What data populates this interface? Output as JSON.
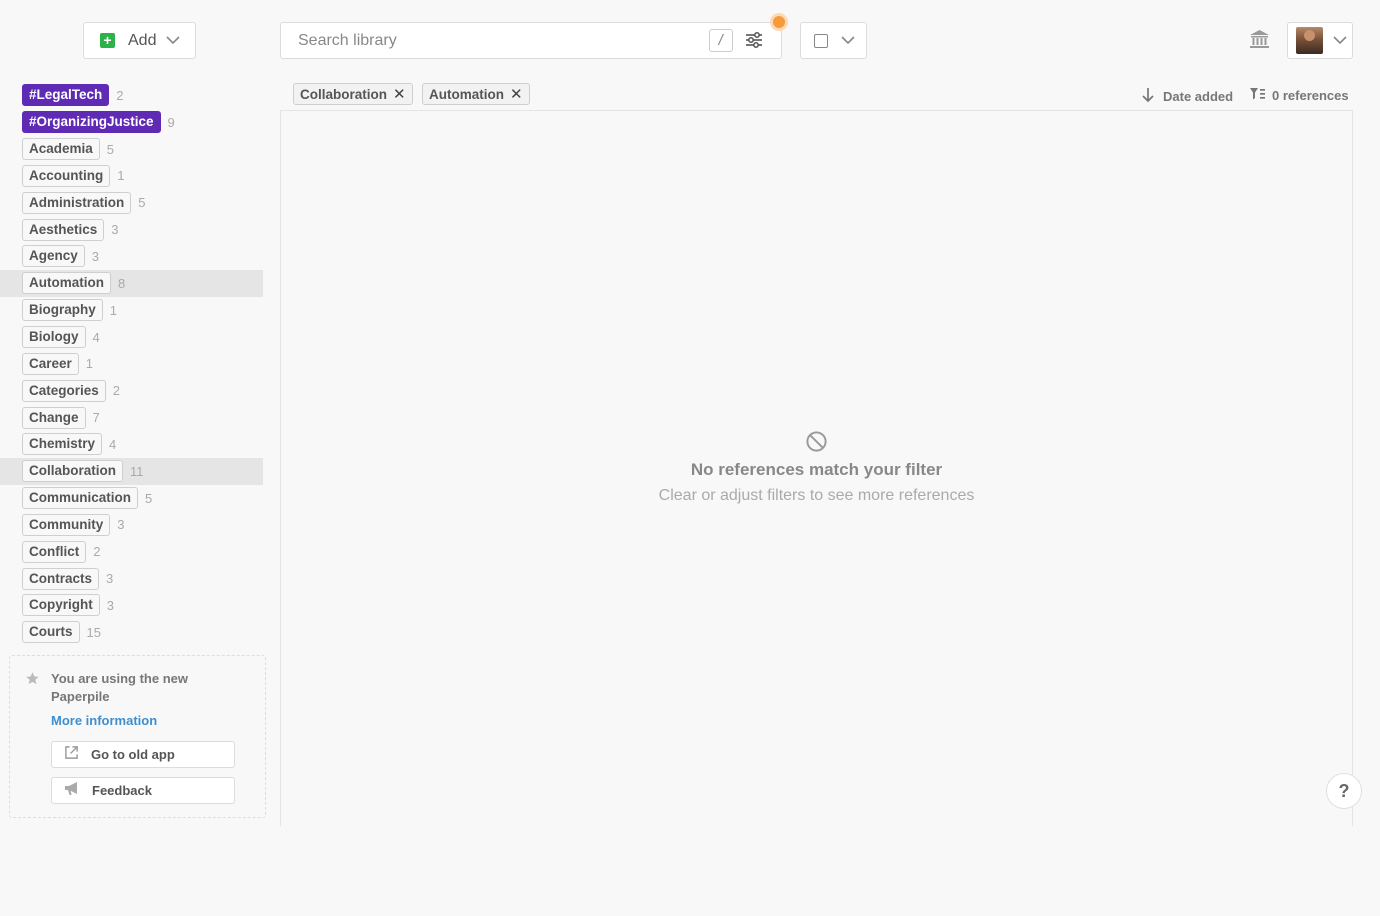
{
  "toolbar": {
    "add_label": "Add",
    "search_placeholder": "Search library",
    "search_value": "",
    "shortcut_key": "/"
  },
  "sidebar": {
    "tags": [
      {
        "label": "#LegalTech",
        "count": "2",
        "style": "purple",
        "selected": false
      },
      {
        "label": "#OrganizingJustice",
        "count": "9",
        "style": "purple",
        "selected": false
      },
      {
        "label": "Academia",
        "count": "5",
        "style": "default",
        "selected": false
      },
      {
        "label": "Accounting",
        "count": "1",
        "style": "default",
        "selected": false
      },
      {
        "label": "Administration",
        "count": "5",
        "style": "default",
        "selected": false
      },
      {
        "label": "Aesthetics",
        "count": "3",
        "style": "default",
        "selected": false
      },
      {
        "label": "Agency",
        "count": "3",
        "style": "default",
        "selected": false
      },
      {
        "label": "Automation",
        "count": "8",
        "style": "default",
        "selected": true
      },
      {
        "label": "Biography",
        "count": "1",
        "style": "default",
        "selected": false
      },
      {
        "label": "Biology",
        "count": "4",
        "style": "default",
        "selected": false
      },
      {
        "label": "Career",
        "count": "1",
        "style": "default",
        "selected": false
      },
      {
        "label": "Categories",
        "count": "2",
        "style": "default",
        "selected": false
      },
      {
        "label": "Change",
        "count": "7",
        "style": "default",
        "selected": false
      },
      {
        "label": "Chemistry",
        "count": "4",
        "style": "default",
        "selected": false
      },
      {
        "label": "Collaboration",
        "count": "11",
        "style": "default",
        "selected": true
      },
      {
        "label": "Communication",
        "count": "5",
        "style": "default",
        "selected": false
      },
      {
        "label": "Community",
        "count": "3",
        "style": "default",
        "selected": false
      },
      {
        "label": "Conflict",
        "count": "2",
        "style": "default",
        "selected": false
      },
      {
        "label": "Contracts",
        "count": "3",
        "style": "default",
        "selected": false
      },
      {
        "label": "Copyright",
        "count": "3",
        "style": "default",
        "selected": false
      },
      {
        "label": "Courts",
        "count": "15",
        "style": "default",
        "selected": false
      }
    ],
    "info": {
      "message": "You are using the new Paperpile",
      "more_link": "More information",
      "old_app_label": "Go to old app",
      "feedback_label": "Feedback"
    }
  },
  "filters": {
    "active": [
      {
        "label": "Collaboration",
        "remove": "✕"
      },
      {
        "label": "Automation",
        "remove": "✕"
      }
    ],
    "sort_label": "Date added",
    "ref_count_label": "0 references"
  },
  "empty_state": {
    "title": "No references match your filter",
    "subtitle": "Clear or adjust filters to see more references"
  },
  "help": {
    "label": "?"
  },
  "colors": {
    "accent_green": "#2db24a",
    "tag_purple": "#5f2bb5",
    "notification": "#f79a3b",
    "link": "#3e8ed0"
  }
}
